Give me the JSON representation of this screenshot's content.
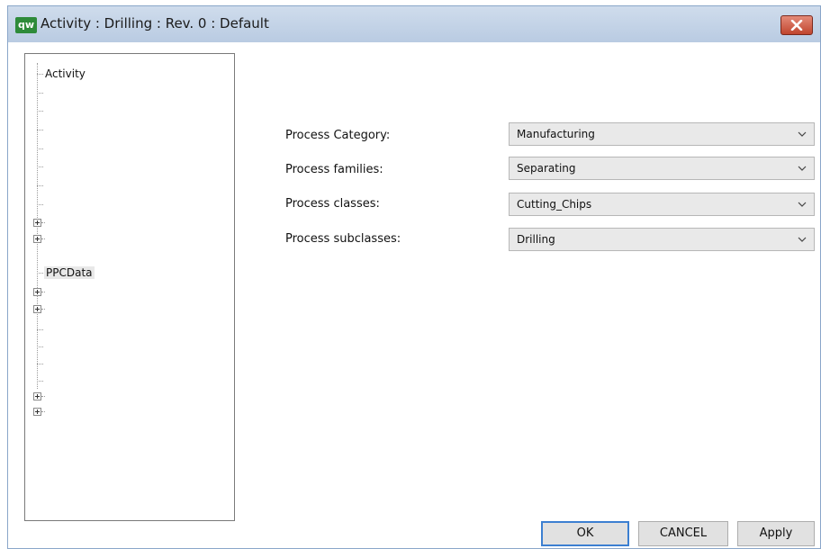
{
  "window": {
    "title": "Activity : Drilling : Rev. 0 : Default",
    "app_icon_text": "qw",
    "close_icon": "close-icon"
  },
  "tree": {
    "root_label": "Activity",
    "selected_label": "PPCData"
  },
  "form": {
    "fields": [
      {
        "label": "Process Category:",
        "value": "Manufacturing"
      },
      {
        "label": "Process families:",
        "value": "Separating"
      },
      {
        "label": "Process classes:",
        "value": "Cutting_Chips"
      },
      {
        "label": "Process subclasses:",
        "value": "Drilling"
      }
    ]
  },
  "buttons": {
    "ok": "OK",
    "cancel": "CANCEL",
    "apply": "Apply"
  },
  "colors": {
    "titlebar": "#c3d3e8",
    "close_button": "#d0604a",
    "combo_bg": "#e9e9e9",
    "default_button_border": "#3c7fd1"
  }
}
